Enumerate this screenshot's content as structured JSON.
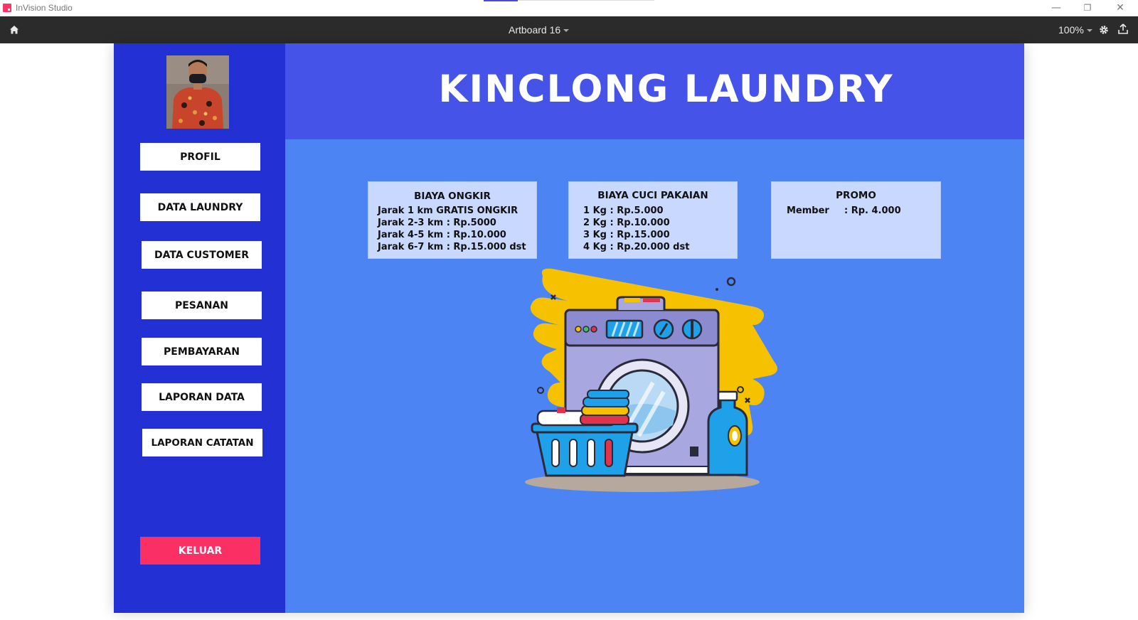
{
  "app": {
    "name": "InVision Studio",
    "window_controls": {
      "minimize": "—",
      "restore": "❐",
      "close": "✕"
    }
  },
  "toolbar": {
    "artboard_name": "Artboard 16",
    "zoom": "100%"
  },
  "sidebar": {
    "nav": [
      {
        "label": "PROFIL"
      },
      {
        "label": "DATA LAUNDRY"
      },
      {
        "label": "DATA CUSTOMER"
      },
      {
        "label": "PESANAN"
      },
      {
        "label": "PEMBAYARAN"
      },
      {
        "label": "LAPORAN DATA"
      },
      {
        "label": "LAPORAN CATATAN"
      }
    ],
    "logout_label": "KELUAR"
  },
  "header": {
    "brand": "KINCLONG LAUNDRY"
  },
  "cards": {
    "ongkir": {
      "title": "BIAYA ONGKIR",
      "lines": [
        "Jarak 1 km GRATIS ONGKIR",
        "Jarak 2-3 km : Rp.5000",
        "Jarak 4-5 km : Rp.10.000",
        "Jarak 6-7 km : Rp.15.000 dst"
      ]
    },
    "cuci": {
      "title": "BIAYA CUCI PAKAIAN",
      "lines": [
        "1 Kg : Rp.5.000",
        "2 Kg : Rp.10.000",
        "3 Kg : Rp.15.000",
        "4 Kg : Rp.20.000 dst"
      ]
    },
    "promo": {
      "title": "PROMO",
      "member_label": "Member",
      "member_value": ": Rp. 4.000"
    }
  },
  "colors": {
    "sidebar": "#2330d4",
    "header": "#4653e9",
    "main": "#4d84f4",
    "card": "#c8d8ff",
    "logout": "#fa2f63"
  },
  "icons": [
    "home-icon",
    "gear-icon",
    "share-icon",
    "chevron-down-icon"
  ]
}
